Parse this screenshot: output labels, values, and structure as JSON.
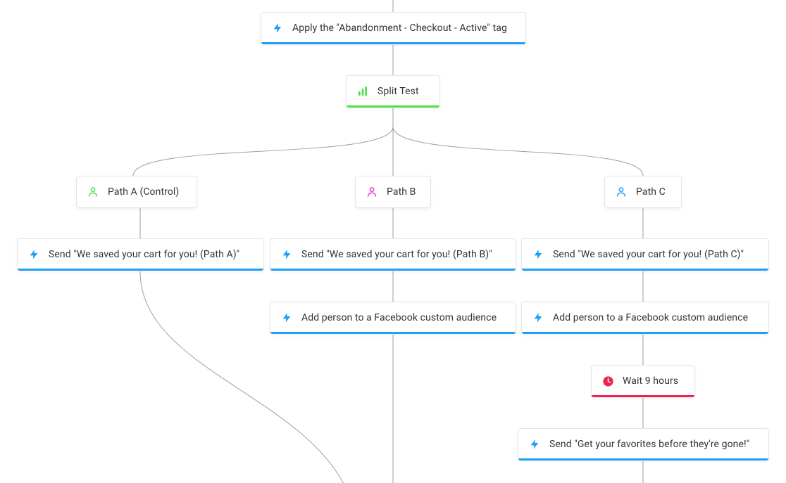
{
  "colors": {
    "blue": "#1f9ef3",
    "green": "#4be04b",
    "magenta": "#e23bd1",
    "red": "#ec2352"
  },
  "nodes": {
    "apply_tag": {
      "label": "Apply the \"Abandonment - Checkout - Active\" tag",
      "icon": "bolt-icon",
      "accent": "blue"
    },
    "split_test": {
      "label": "Split Test",
      "icon": "bar-chart-icon",
      "accent": "green"
    },
    "path_a": {
      "label": "Path A (Control)",
      "icon": "person-icon",
      "iconColor": "green"
    },
    "path_b": {
      "label": "Path B",
      "icon": "person-icon",
      "iconColor": "magenta"
    },
    "path_c": {
      "label": "Path C",
      "icon": "person-icon",
      "iconColor": "blue"
    },
    "send_a": {
      "label": "Send \"We saved your cart for you! (Path A)\"",
      "icon": "bolt-icon",
      "accent": "blue"
    },
    "send_b": {
      "label": "Send \"We saved your cart for you! (Path B)\"",
      "icon": "bolt-icon",
      "accent": "blue"
    },
    "send_c": {
      "label": "Send \"We saved your cart for you! (Path C)\"",
      "icon": "bolt-icon",
      "accent": "blue"
    },
    "fb_b": {
      "label": "Add person to a Facebook custom audience",
      "icon": "bolt-icon",
      "accent": "blue"
    },
    "fb_c": {
      "label": "Add person to a Facebook custom audience",
      "icon": "bolt-icon",
      "accent": "blue"
    },
    "wait9": {
      "label": "Wait 9 hours",
      "icon": "clock-icon",
      "accent": "red"
    },
    "send_favs": {
      "label": "Send \"Get your favorites before they're gone!\"",
      "icon": "bolt-icon",
      "accent": "blue"
    }
  }
}
